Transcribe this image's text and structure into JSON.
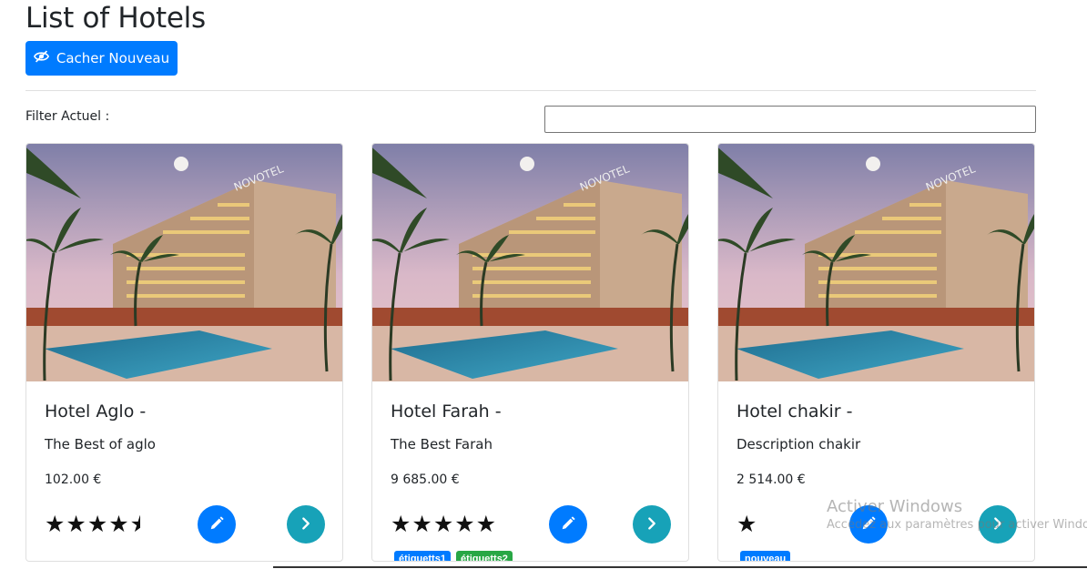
{
  "page": {
    "title": "List of Hotels"
  },
  "toolbar": {
    "toggle_label": "Cacher Nouveau",
    "toggle_icon": "eye-slash-icon"
  },
  "filter": {
    "label": "Filter Actuel :",
    "value": ""
  },
  "hotels": [
    {
      "name": "Hotel Aglo -",
      "description": "The Best of aglo",
      "price": "102.00 €",
      "rating": 4.5,
      "rating_display": "★★★★",
      "badges": []
    },
    {
      "name": "Hotel Farah -",
      "description": "The Best Farah",
      "price": "9 685.00 €",
      "rating": 5,
      "rating_display": "★★★★★",
      "badges": [
        {
          "label": "étiquetts1",
          "color": "#007bff"
        },
        {
          "label": "étiquetts2",
          "color": "#28a745"
        }
      ]
    },
    {
      "name": "Hotel chakir -",
      "description": "Description chakir",
      "price": "2 514.00 €",
      "rating": 1,
      "rating_display": "★",
      "badges": [
        {
          "label": "nouveau",
          "color": "#007bff"
        }
      ]
    }
  ],
  "card_icons": {
    "edit": "pencil-icon",
    "next": "chevron-right-icon"
  },
  "colors": {
    "primary": "#007bff",
    "info": "#17a2b8",
    "success": "#28a745"
  },
  "watermark": {
    "line1": "Activer Windows",
    "line2": "Accédez aux paramètres pour activer Windo"
  }
}
